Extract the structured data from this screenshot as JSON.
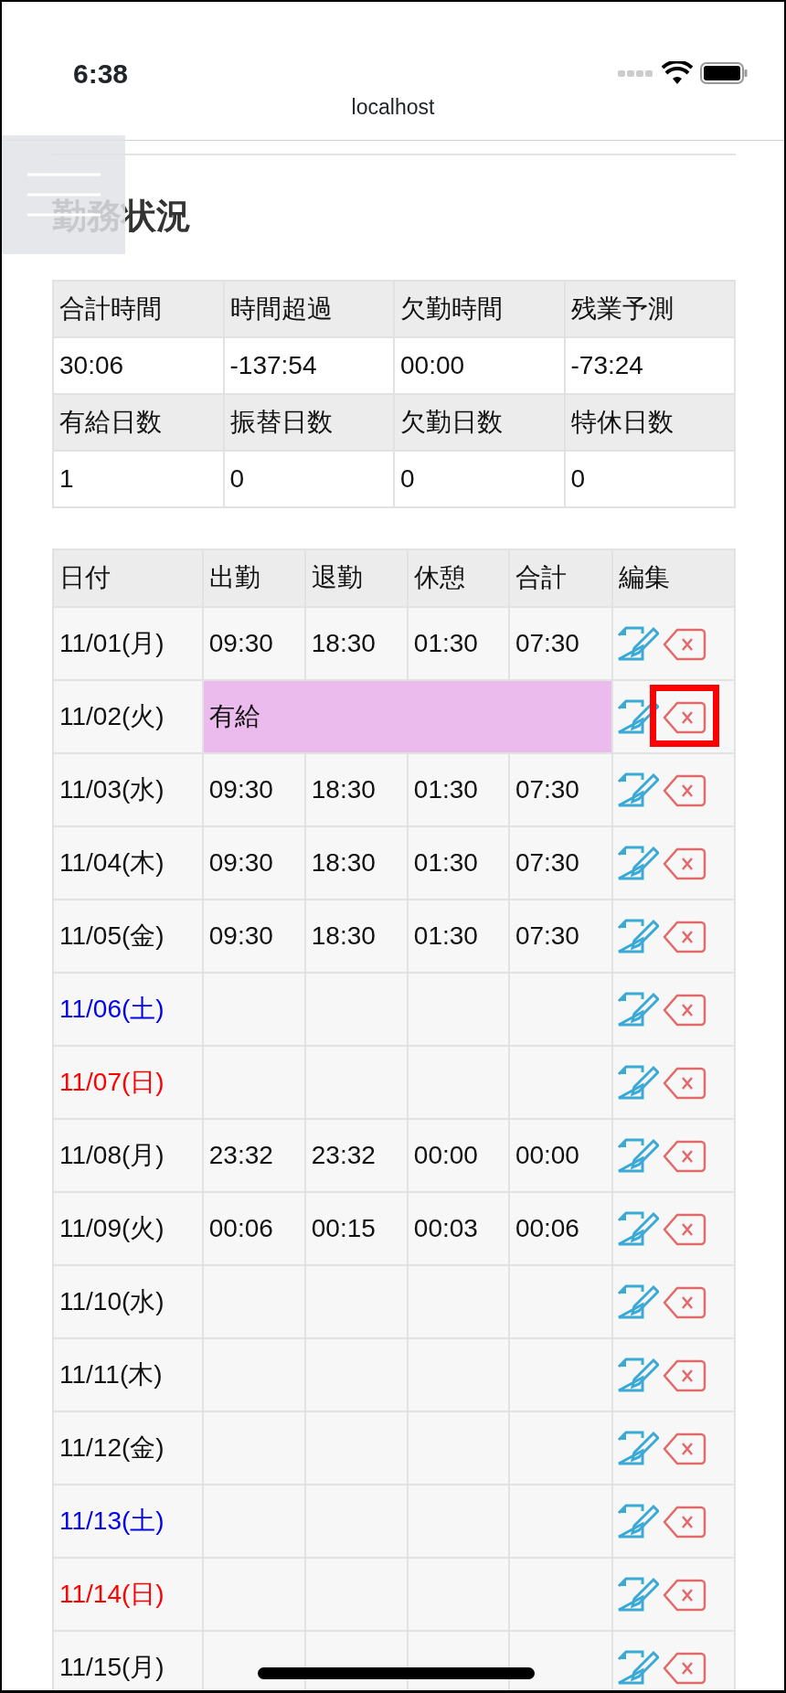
{
  "status_bar": {
    "time": "6:38"
  },
  "browser": {
    "url": "localhost"
  },
  "menu_button": {
    "kind": "hamburger"
  },
  "title": "勤務状況",
  "summary": [
    {
      "headers": [
        "合計時間",
        "時間超過",
        "欠勤時間",
        "残業予測"
      ],
      "values": [
        "30:06",
        "-137:54",
        "00:00",
        "-73:24"
      ]
    },
    {
      "headers": [
        "有給日数",
        "振替日数",
        "欠勤日数",
        "特休日数"
      ],
      "values": [
        "1",
        "0",
        "0",
        "0"
      ]
    }
  ],
  "table": {
    "columns": [
      "日付",
      "出勤",
      "退勤",
      "休憩",
      "合計",
      "編集"
    ],
    "rows": [
      {
        "date": "11/01(月)",
        "color": "#111111",
        "kind": "time",
        "cells": [
          "09:30",
          "18:30",
          "01:30",
          "07:30"
        ],
        "highlighted": false
      },
      {
        "date": "11/02(火)",
        "color": "#111111",
        "kind": "leave",
        "leave": {
          "label": "有給",
          "color": "#ecbbed"
        },
        "highlighted": true
      },
      {
        "date": "11/03(水)",
        "color": "#111111",
        "kind": "time",
        "cells": [
          "09:30",
          "18:30",
          "01:30",
          "07:30"
        ],
        "highlighted": false
      },
      {
        "date": "11/04(木)",
        "color": "#111111",
        "kind": "time",
        "cells": [
          "09:30",
          "18:30",
          "01:30",
          "07:30"
        ],
        "highlighted": false
      },
      {
        "date": "11/05(金)",
        "color": "#111111",
        "kind": "time",
        "cells": [
          "09:30",
          "18:30",
          "01:30",
          "07:30"
        ],
        "highlighted": false
      },
      {
        "date": "11/06(土)",
        "color": "#0000ee",
        "kind": "empty",
        "highlighted": false
      },
      {
        "date": "11/07(日)",
        "color": "#ff0000",
        "kind": "empty",
        "highlighted": false
      },
      {
        "date": "11/08(月)",
        "color": "#111111",
        "kind": "time",
        "cells": [
          "23:32",
          "23:32",
          "00:00",
          "00:00"
        ],
        "highlighted": false
      },
      {
        "date": "11/09(火)",
        "color": "#111111",
        "kind": "time",
        "cells": [
          "00:06",
          "00:15",
          "00:03",
          "00:06"
        ],
        "highlighted": false
      },
      {
        "date": "11/10(水)",
        "color": "#111111",
        "kind": "empty",
        "highlighted": false
      },
      {
        "date": "11/11(木)",
        "color": "#111111",
        "kind": "empty",
        "highlighted": false
      },
      {
        "date": "11/12(金)",
        "color": "#111111",
        "kind": "empty",
        "highlighted": false
      },
      {
        "date": "11/13(土)",
        "color": "#0000ee",
        "kind": "empty",
        "highlighted": false
      },
      {
        "date": "11/14(日)",
        "color": "#ff0000",
        "kind": "empty",
        "highlighted": false
      },
      {
        "date": "11/15(月)",
        "color": "#111111",
        "kind": "empty",
        "highlighted": false
      }
    ]
  }
}
